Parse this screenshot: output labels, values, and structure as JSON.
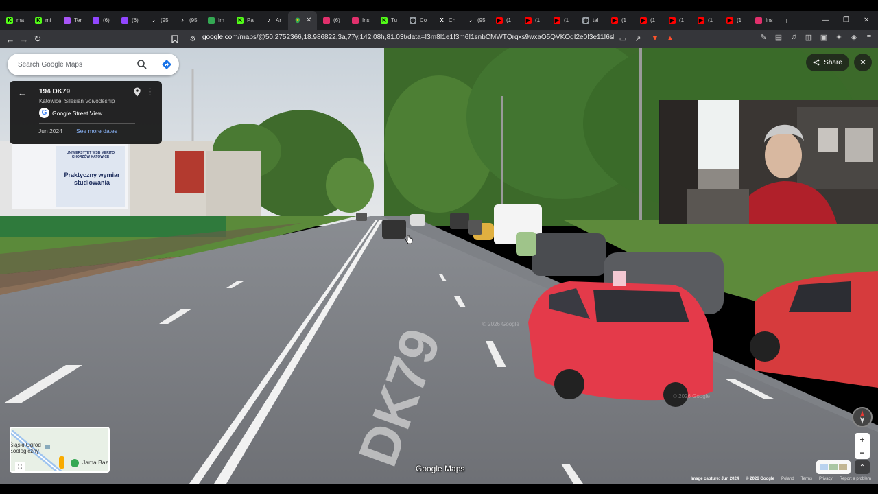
{
  "browser": {
    "tabs": [
      {
        "label": "ma",
        "icon": "k-icon",
        "color": "#53fc18"
      },
      {
        "label": "mi",
        "icon": "k-icon",
        "color": "#53fc18"
      },
      {
        "label": "Ter",
        "icon": "tenor-icon",
        "color": "#a855f7"
      },
      {
        "label": "(6)",
        "icon": "twitch-icon",
        "color": "#9146ff"
      },
      {
        "label": "(6)",
        "icon": "twitch-icon",
        "color": "#9146ff"
      },
      {
        "label": "(95",
        "icon": "tiktok-icon",
        "color": "#ffffff"
      },
      {
        "label": "(95",
        "icon": "tiktok-icon",
        "color": "#ffffff"
      },
      {
        "label": "Im",
        "icon": "image-icon",
        "color": "#34a853"
      },
      {
        "label": "Pa",
        "icon": "k-icon",
        "color": "#53fc18"
      },
      {
        "label": "Ar",
        "icon": "tiktok-icon",
        "color": "#ffffff"
      }
    ],
    "tabs2": [
      {
        "label": "(6)",
        "icon": "instagram-icon",
        "color": "#e1306c"
      },
      {
        "label": "Ins",
        "icon": "instagram-icon",
        "color": "#e1306c"
      },
      {
        "label": "Tu",
        "icon": "k-icon",
        "color": "#53fc18"
      },
      {
        "label": "Co",
        "icon": "globe-icon",
        "color": "#9aa0a6"
      },
      {
        "label": "Ch",
        "icon": "x-icon",
        "color": "#ffffff"
      },
      {
        "label": "(95",
        "icon": "tiktok-icon",
        "color": "#ffffff"
      },
      {
        "label": "(1",
        "icon": "youtube-icon",
        "color": "#ff0000"
      },
      {
        "label": "(1",
        "icon": "youtube-icon",
        "color": "#ff0000"
      },
      {
        "label": "(1",
        "icon": "youtube-icon",
        "color": "#ff0000"
      },
      {
        "label": "tal",
        "icon": "globe-icon",
        "color": "#9aa0a6"
      },
      {
        "label": "(1",
        "icon": "youtube-icon",
        "color": "#ff0000"
      },
      {
        "label": "(1",
        "icon": "youtube-icon",
        "color": "#ff0000"
      },
      {
        "label": "(1",
        "icon": "youtube-icon",
        "color": "#ff0000"
      },
      {
        "label": "(1",
        "icon": "youtube-icon",
        "color": "#ff0000"
      },
      {
        "label": "(1",
        "icon": "youtube-icon",
        "color": "#ff0000"
      },
      {
        "label": "Ins",
        "icon": "instagram-icon",
        "color": "#e1306c"
      }
    ],
    "url_host": "google.com",
    "url_rest": "/maps/@50.2752366,18.986822,3a,77y,142.08h,81.03t/data=!3m8!1e1!3m6!1snbCMWTQrqxs9wxaO5QVKOgI2e0!3e11!6shttps:%2F..."
  },
  "maps": {
    "search_placeholder": "Search Google Maps",
    "location_title": "194 DK79",
    "location_subtitle": "Katowice, Silesian Voivodeship",
    "source": "Google Street View",
    "capture_month": "Jun 2024",
    "more_dates": "See more dates",
    "share_label": "Share",
    "logo_text": "Google Maps",
    "minimap": {
      "label1": "Śląski Ogród Zoologiczny",
      "label2": "Jama Baz"
    },
    "footer": {
      "capture": "Image capture: Jun 2024",
      "copyright": "© 2026 Google",
      "country": "Poland",
      "terms": "Terms",
      "privacy": "Privacy",
      "report": "Report a problem"
    },
    "road_marking": "DK79",
    "billboard_text": "Praktyczny wymiar studiowania",
    "billboard_header": "UNIWERSYTET WSB MERITO CHORZÓW KATOWICE"
  }
}
